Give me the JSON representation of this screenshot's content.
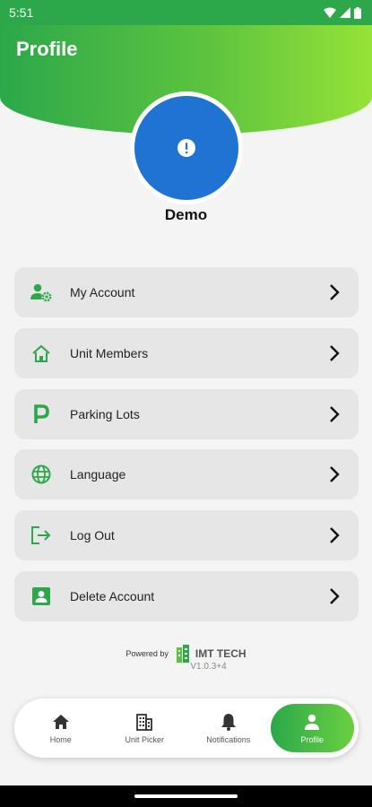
{
  "status_bar": {
    "time": "5:51"
  },
  "header": {
    "title": "Profile"
  },
  "profile": {
    "name": "Demo",
    "avatar_icon": "alert-circle-icon"
  },
  "menu": [
    {
      "label": "My Account",
      "icon": "account-settings-icon"
    },
    {
      "label": "Unit Members",
      "icon": "home-icon"
    },
    {
      "label": "Parking Lots",
      "icon": "parking-icon"
    },
    {
      "label": "Language",
      "icon": "globe-icon"
    },
    {
      "label": "Log Out",
      "icon": "logout-icon"
    },
    {
      "label": "Delete Account",
      "icon": "account-box-icon"
    }
  ],
  "footer": {
    "powered_by": "Powered by",
    "brand": "IMT TECH",
    "version": "V1.0.3+4"
  },
  "bottom_nav": [
    {
      "label": "Home",
      "icon": "home-icon",
      "active": false
    },
    {
      "label": "Unit Picker",
      "icon": "building-icon",
      "active": false
    },
    {
      "label": "Notifications",
      "icon": "bell-icon",
      "active": false
    },
    {
      "label": "Profile",
      "icon": "person-icon",
      "active": true
    }
  ],
  "colors": {
    "accent": "#2ca84a",
    "accent_light": "#96e238",
    "avatar_bg": "#1f73d2",
    "card_bg": "#e6e6e6"
  }
}
